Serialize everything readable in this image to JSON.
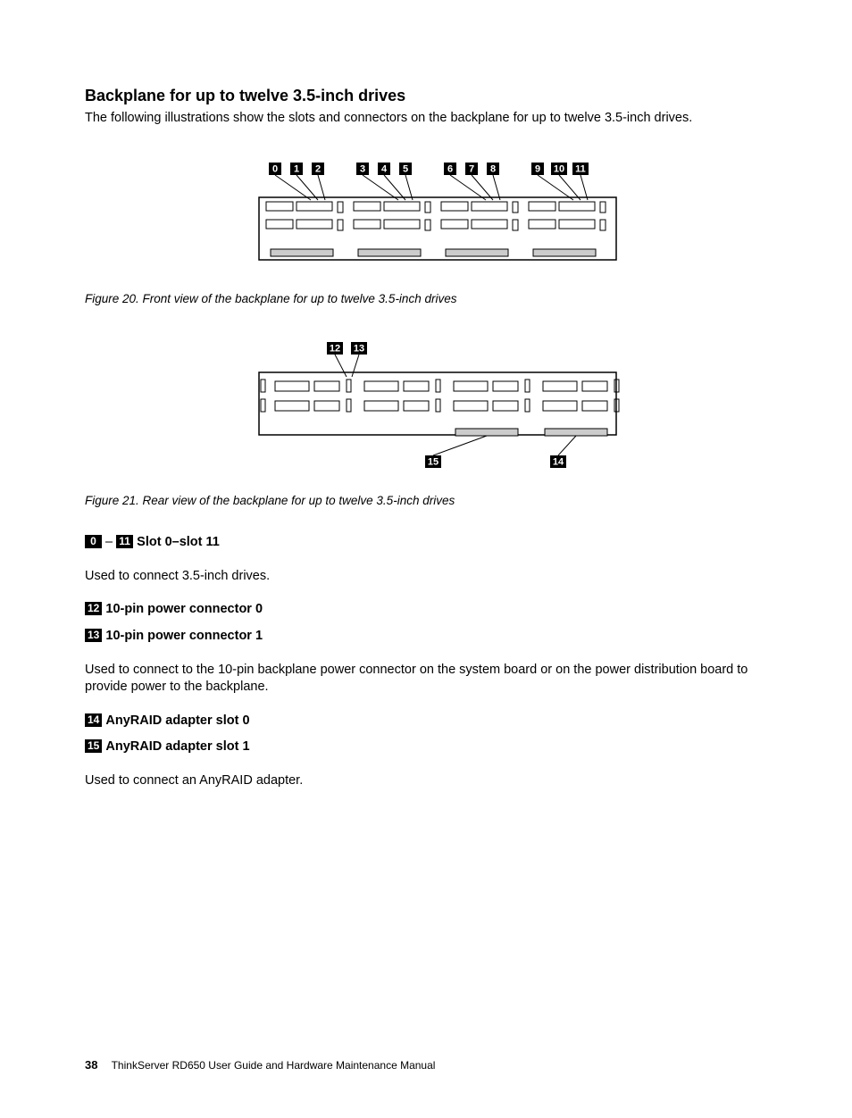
{
  "heading": "Backplane for up to twelve 3.5-inch drives",
  "intro": "The following illustrations show the slots and connectors on the backplane for up to twelve 3.5-inch drives.",
  "figure20": {
    "callouts": [
      "0",
      "1",
      "2",
      "3",
      "4",
      "5",
      "6",
      "7",
      "8",
      "9",
      "10",
      "11"
    ],
    "caption": "Figure 20.  Front view of the backplane for up to twelve 3.5-inch drives"
  },
  "figure21": {
    "callouts_top": [
      "12",
      "13"
    ],
    "callouts_bottom_right": "14",
    "callouts_bottom_left": "15",
    "caption": "Figure 21.  Rear view of the backplane for up to twelve 3.5-inch drives"
  },
  "items": {
    "slots": {
      "range_a": "0",
      "range_b": "11",
      "title": "Slot 0–slot 11",
      "body": "Used to connect 3.5-inch drives."
    },
    "pwr0": {
      "num": "12",
      "title": "10-pin power connector 0"
    },
    "pwr1": {
      "num": "13",
      "title": "10-pin power connector 1"
    },
    "pwr_body": "Used to connect to the 10-pin backplane power connector on the system board or on the power distribution board to provide power to the backplane.",
    "raid0": {
      "num": "14",
      "title": "AnyRAID adapter slot 0"
    },
    "raid1": {
      "num": "15",
      "title": "AnyRAID adapter slot 1"
    },
    "raid_body": "Used to connect an AnyRAID adapter."
  },
  "footer": {
    "page": "38",
    "title": "ThinkServer RD650 User Guide and Hardware Maintenance Manual"
  }
}
